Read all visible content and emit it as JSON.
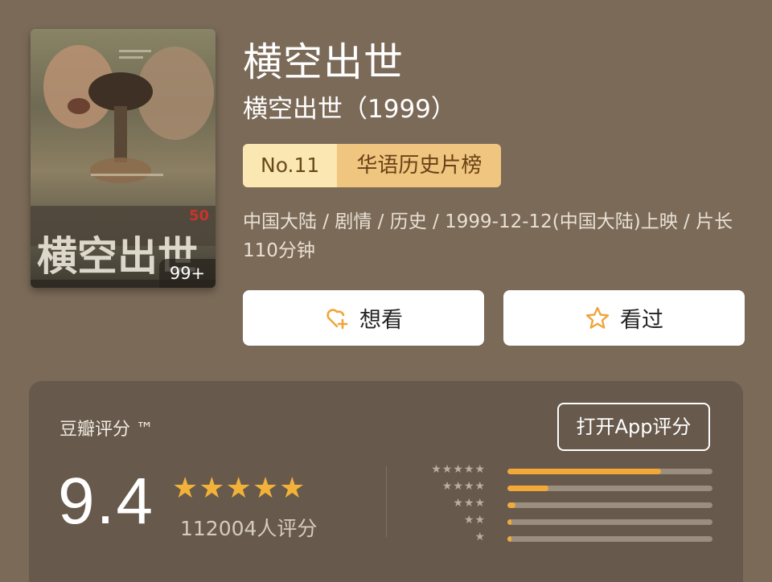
{
  "movie": {
    "title": "横空出世",
    "subtitle": "横空出世（1999）",
    "poster_badge": "99+",
    "poster_title_art": "横空出世",
    "poster_anniv": "50",
    "rank": {
      "number": "No.11",
      "list_name": "华语历史片榜"
    },
    "meta": "中国大陆 / 剧情 / 历史 / 1999-12-12(中国大陆)上映 / 片长110分钟"
  },
  "actions": {
    "want_label": "想看",
    "want_icon": "heart-plus-icon",
    "seen_label": "看过",
    "seen_icon": "star-outline-icon"
  },
  "rating": {
    "label": "豆瓣评分 ™",
    "open_app_label": "打开App评分",
    "score": "9.4",
    "stars_display": "★★★★★",
    "count_text": "112004人评分",
    "distribution": [
      {
        "stars": "★★★★★",
        "fraction": 0.75
      },
      {
        "stars": "★★★★",
        "fraction": 0.2
      },
      {
        "stars": "★★★",
        "fraction": 0.04
      },
      {
        "stars": "★★",
        "fraction": 0.005
      },
      {
        "stars": "★",
        "fraction": 0.005
      }
    ]
  },
  "colors": {
    "background": "#7b6a58",
    "accent_star": "#f2b23a",
    "rank_no_bg": "#fbe7b1",
    "rank_name_bg": "#f0c57f"
  }
}
